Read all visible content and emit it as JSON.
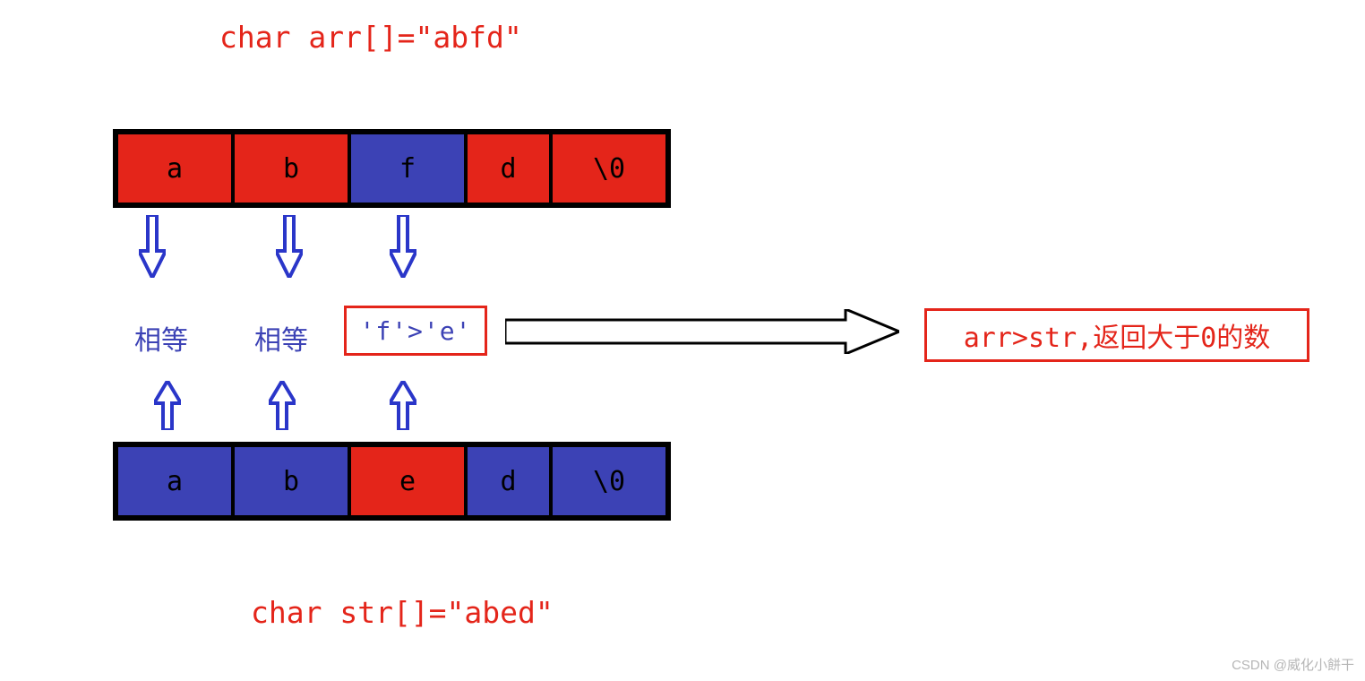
{
  "titles": {
    "top": "char arr[]=\"abfd\"",
    "bottom": "char str[]=\"abed\""
  },
  "arrays": {
    "top": [
      {
        "value": "a",
        "color": "red"
      },
      {
        "value": "b",
        "color": "red"
      },
      {
        "value": "f",
        "color": "blue"
      },
      {
        "value": "d",
        "color": "red"
      },
      {
        "value": "\\0",
        "color": "red"
      }
    ],
    "bottom": [
      {
        "value": "a",
        "color": "blue"
      },
      {
        "value": "b",
        "color": "blue"
      },
      {
        "value": "e",
        "color": "red"
      },
      {
        "value": "d",
        "color": "blue"
      },
      {
        "value": "\\0",
        "color": "blue"
      }
    ]
  },
  "labels": {
    "equal1": "相等",
    "equal2": "相等",
    "compare": "'f'>'e'"
  },
  "result": "arr>str,返回大于0的数",
  "watermark": "CSDN @威化小餅干",
  "colors": {
    "red": "#e4251a",
    "blue": "#3c42b5",
    "arrowBlue": "#2a36c9"
  }
}
